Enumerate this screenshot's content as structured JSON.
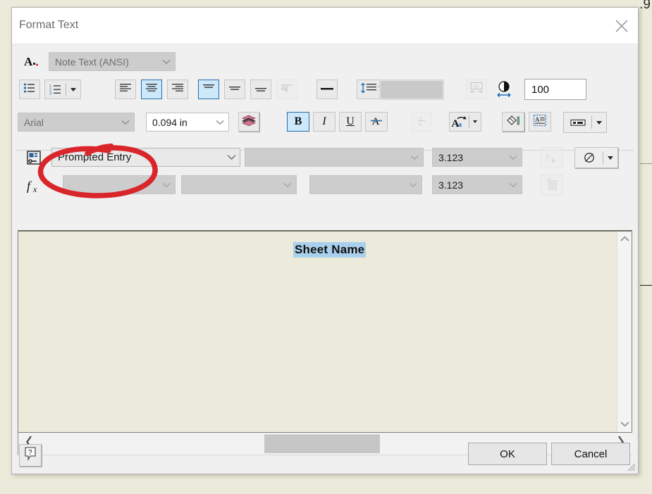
{
  "background": {
    "fragment_text": ".9"
  },
  "dialog": {
    "title": "Format Text",
    "close_icon": "close-icon"
  },
  "style_row": {
    "icon": "text-style-icon",
    "style_value": "Note Text (ANSI)"
  },
  "paragraph_row": {
    "buttons": [
      {
        "name": "bulleted-list-button",
        "icon": "bulleted-list-icon",
        "state": "normal"
      },
      {
        "name": "numbered-list-button",
        "icon": "numbered-list-icon",
        "state": "normal"
      },
      {
        "name": "align-left-button",
        "icon": "align-left-icon",
        "state": "normal"
      },
      {
        "name": "align-center-button",
        "icon": "align-center-icon",
        "state": "active"
      },
      {
        "name": "align-right-button",
        "icon": "align-right-icon",
        "state": "normal"
      },
      {
        "name": "align-top-button",
        "icon": "align-top-icon",
        "state": "active"
      },
      {
        "name": "align-middle-button",
        "icon": "align-middle-icon",
        "state": "normal"
      },
      {
        "name": "align-bottom-button",
        "icon": "align-bottom-icon",
        "state": "normal"
      },
      {
        "name": "text-rotate-button",
        "icon": "rotate-text-icon",
        "state": "disabled"
      },
      {
        "name": "underline-style-button",
        "icon": "horizontal-rule-icon",
        "state": "normal"
      },
      {
        "name": "line-spacing-button",
        "icon": "line-spacing-icon",
        "state": "normal"
      }
    ],
    "color_swatch": "",
    "fit-text-icon": "fit-text-icon",
    "width-factor-icon": "width-factor-icon",
    "width_value": "100"
  },
  "font_row": {
    "font_name": "Arial",
    "text_height": "0.094 in",
    "buttons": [
      {
        "name": "layer-color-button",
        "icon": "stack-color-icon"
      },
      {
        "name": "bold-button",
        "icon": "bold-icon",
        "label": "B",
        "state": "active"
      },
      {
        "name": "italic-button",
        "icon": "italic-icon",
        "label": "I",
        "state": "normal"
      },
      {
        "name": "underline-button",
        "icon": "underline-icon",
        "label": "U",
        "state": "normal"
      },
      {
        "name": "strikethrough-button",
        "icon": "strikethrough-icon",
        "label": "A",
        "state": "normal"
      },
      {
        "name": "stacked-fraction-button",
        "icon": "stacked-fraction-icon",
        "state": "disabled"
      },
      {
        "name": "change-case-button",
        "icon": "change-case-icon",
        "state": "normal"
      },
      {
        "name": "background-fill-button",
        "icon": "paint-bucket-icon",
        "state": "normal"
      },
      {
        "name": "text-frame-button",
        "icon": "text-frame-icon",
        "state": "normal"
      },
      {
        "name": "text-field-button",
        "icon": "field-icon",
        "state": "normal"
      }
    ]
  },
  "field_row": {
    "icon": "prompted-entry-icon",
    "entry_type": "Prompted Entry",
    "secondary_value": "",
    "numeric_format": "3.123",
    "insert_var_icon": "insert-variable-icon",
    "symbol_icon": "diameter-symbol-icon"
  },
  "formula_row": {
    "icon": "fx-icon",
    "field_a": "",
    "field_b": "",
    "field_c": "",
    "numeric_format": "3.123",
    "paste_icon": "paste-field-icon"
  },
  "editor": {
    "content": "Sheet Name",
    "selection_color": "#a9d0ec",
    "background_color": "#eceadb",
    "scroll_up_icon": "chevron-up-icon",
    "scroll_down_icon": "chevron-down-icon",
    "scroll_left_icon": "chevron-left-icon",
    "scroll_right_icon": "chevron-right-icon"
  },
  "footer": {
    "help_label": "?",
    "ok_label": "OK",
    "cancel_label": "Cancel",
    "resize_grip": "resize-grip-icon"
  },
  "annotation": {
    "shape": "hand-drawn-ellipse",
    "color": "#d9262a",
    "target": "Prompted Entry"
  }
}
